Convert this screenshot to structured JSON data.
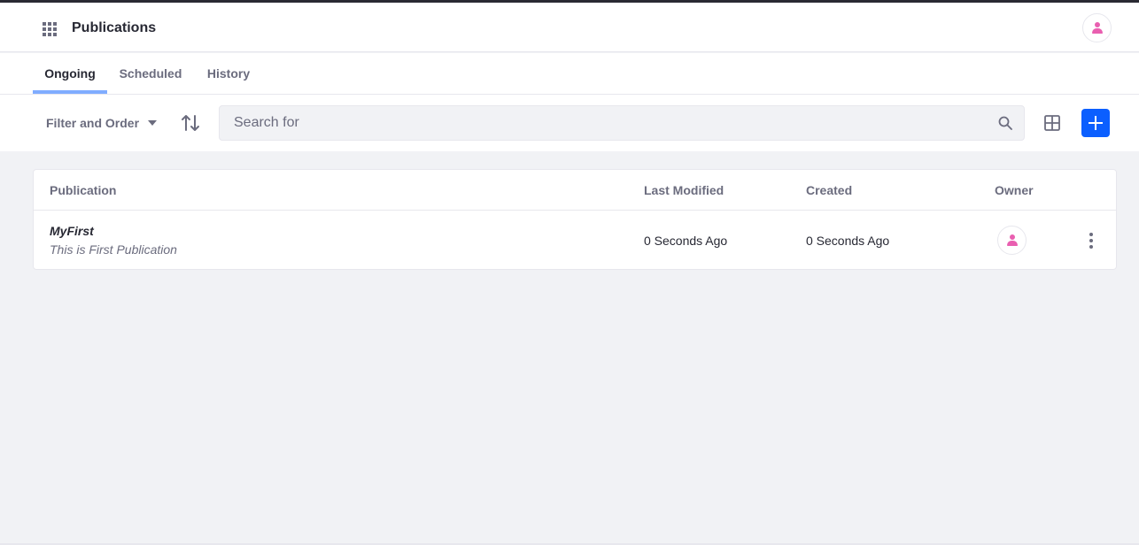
{
  "header": {
    "title": "Publications",
    "apps_icon": "apps-grid-icon",
    "user_icon": "user-icon"
  },
  "tabs": [
    {
      "label": "Ongoing",
      "active": true
    },
    {
      "label": "Scheduled",
      "active": false
    },
    {
      "label": "History",
      "active": false
    }
  ],
  "toolbar": {
    "filter_label": "Filter and Order",
    "search_placeholder": "Search for",
    "search_value": ""
  },
  "table": {
    "columns": [
      "Publication",
      "Last Modified",
      "Created",
      "Owner"
    ],
    "rows": [
      {
        "name": "MyFirst",
        "description": "This is First Publication",
        "last_modified": "0 Seconds Ago",
        "created": "0 Seconds Ago"
      }
    ]
  },
  "colors": {
    "primary": "#0b5fff",
    "tab_indicator": "#80acff",
    "avatar": "#e95fb0",
    "background": "#f1f2f5"
  }
}
